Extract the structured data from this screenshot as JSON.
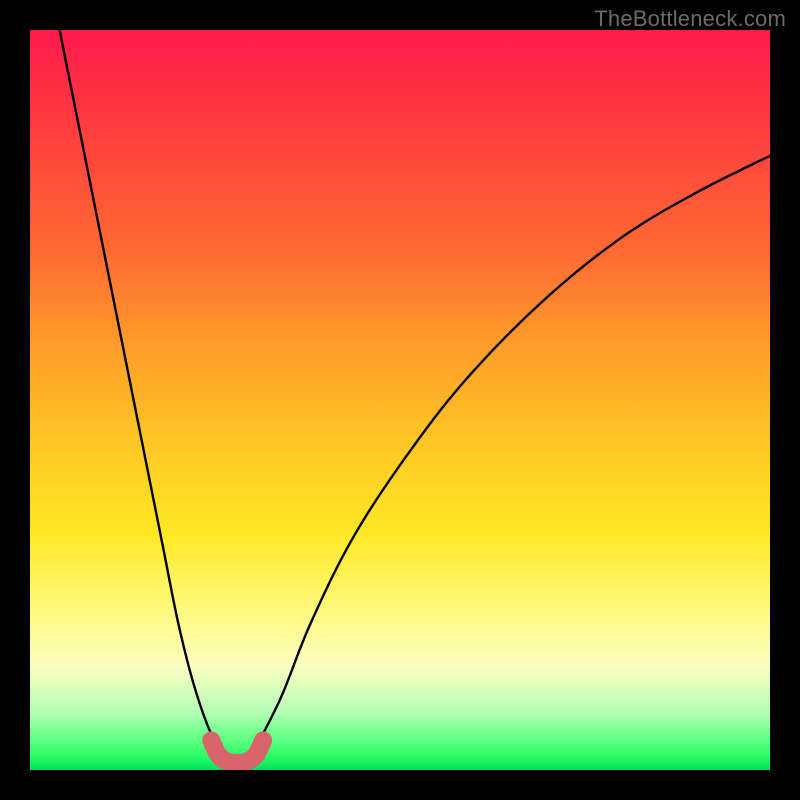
{
  "attribution": "TheBottleneck.com",
  "chart_data": {
    "type": "line",
    "title": "",
    "xlabel": "",
    "ylabel": "",
    "xlim": [
      0,
      100
    ],
    "ylim": [
      0,
      100
    ],
    "grid": false,
    "legend": false,
    "series": [
      {
        "name": "left-branch",
        "color": "#000000",
        "x": [
          4,
          6,
          8,
          10,
          12,
          14,
          16,
          18,
          20,
          22,
          24,
          25.5
        ],
        "y": [
          100,
          90,
          80,
          70,
          60,
          50,
          40,
          30,
          20,
          12,
          6,
          3
        ]
      },
      {
        "name": "right-branch",
        "color": "#000000",
        "x": [
          30.5,
          34,
          38,
          44,
          52,
          60,
          70,
          80,
          90,
          100
        ],
        "y": [
          3,
          10,
          20,
          32,
          44,
          54,
          64,
          72,
          78,
          83
        ]
      },
      {
        "name": "valley-highlight",
        "color": "#d9646b",
        "x": [
          24.5,
          25.5,
          27,
          28,
          29,
          30.5,
          31.5
        ],
        "y": [
          4,
          2,
          1,
          1,
          1,
          2,
          4
        ]
      }
    ],
    "background_gradient": [
      {
        "pos": 0.0,
        "color": "#ff1a4d"
      },
      {
        "pos": 0.12,
        "color": "#ff3a3f"
      },
      {
        "pos": 0.3,
        "color": "#ff6a33"
      },
      {
        "pos": 0.42,
        "color": "#ff9a2a"
      },
      {
        "pos": 0.55,
        "color": "#ffc425"
      },
      {
        "pos": 0.68,
        "color": "#ffe825"
      },
      {
        "pos": 0.78,
        "color": "#fff97a"
      },
      {
        "pos": 0.86,
        "color": "#fbffc0"
      },
      {
        "pos": 0.92,
        "color": "#b6ffb6"
      },
      {
        "pos": 0.98,
        "color": "#2fff66"
      },
      {
        "pos": 1.0,
        "color": "#00e05a"
      }
    ]
  }
}
